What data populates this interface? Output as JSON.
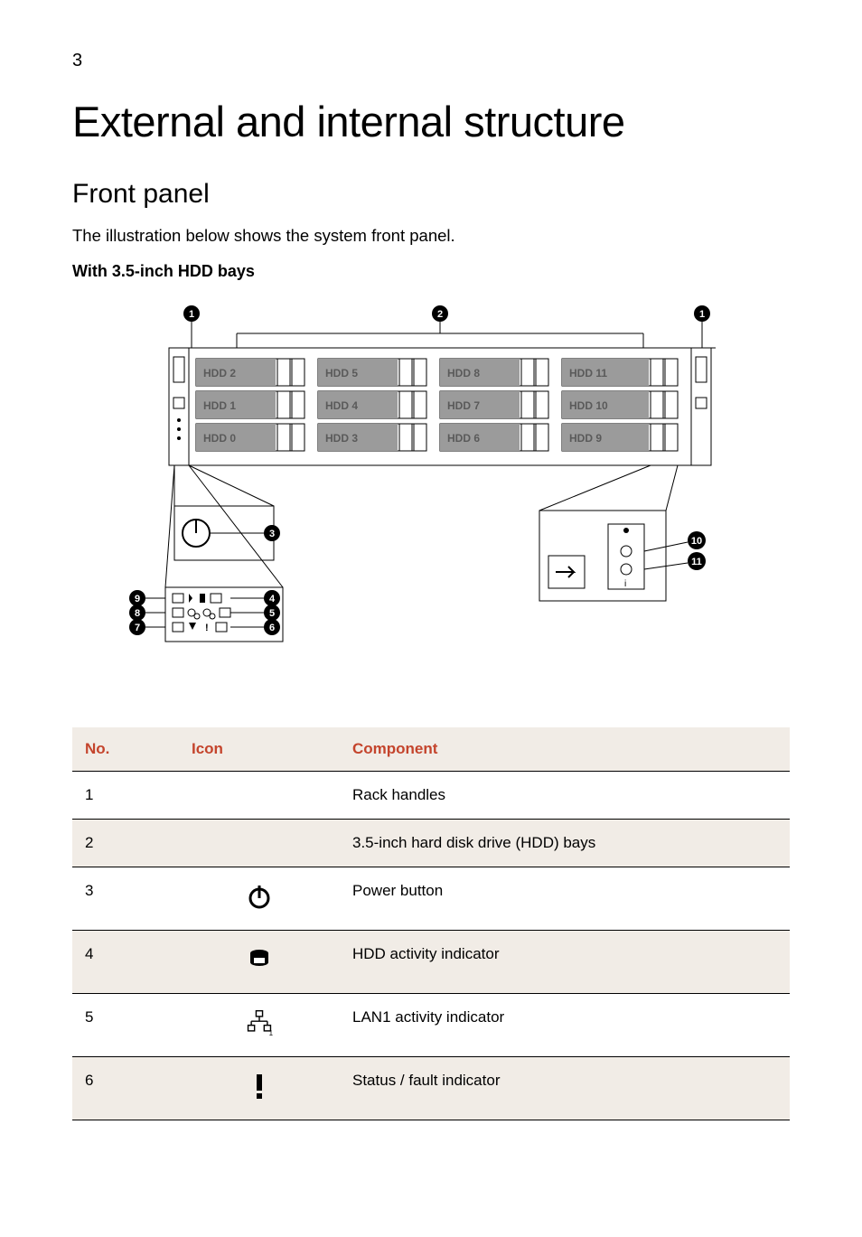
{
  "page_number": "3",
  "title": "External and internal structure",
  "section": "Front panel",
  "intro": "The illustration below shows the system front panel.",
  "subhead": "With 3.5-inch HDD bays",
  "diagram": {
    "callouts": [
      "1",
      "2",
      "3",
      "4",
      "5",
      "6",
      "7",
      "8",
      "9",
      "10",
      "11"
    ],
    "hdd_labels": [
      "HDD 0",
      "HDD 1",
      "HDD 2",
      "HDD 3",
      "HDD 4",
      "HDD 5",
      "HDD 6",
      "HDD 7",
      "HDD 8",
      "HDD 9",
      "HDD 10",
      "HDD 11"
    ]
  },
  "table": {
    "headers": {
      "no": "No.",
      "icon": "Icon",
      "component": "Component"
    },
    "rows": [
      {
        "no": "1",
        "icon": null,
        "component": "Rack handles"
      },
      {
        "no": "2",
        "icon": null,
        "component": "3.5-inch hard disk drive (HDD) bays"
      },
      {
        "no": "3",
        "icon": "power",
        "component": "Power button"
      },
      {
        "no": "4",
        "icon": "hdd",
        "component": "HDD activity indicator"
      },
      {
        "no": "5",
        "icon": "lan1",
        "component": "LAN1 activity indicator"
      },
      {
        "no": "6",
        "icon": "status",
        "component": "Status / fault indicator"
      }
    ]
  }
}
